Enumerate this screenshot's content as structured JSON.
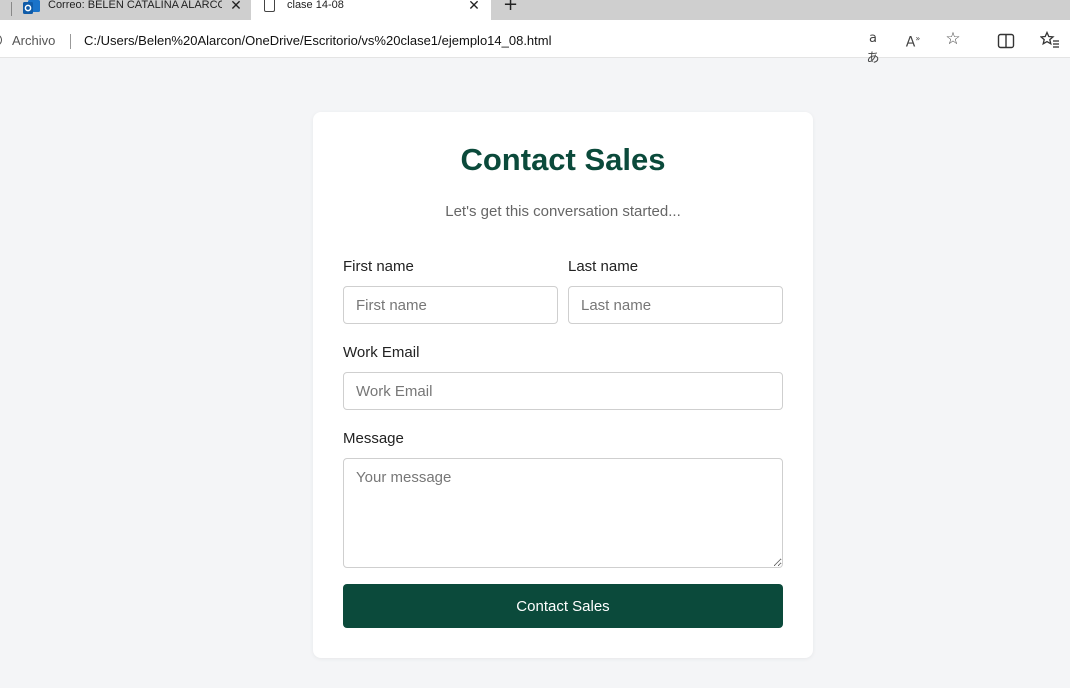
{
  "browser": {
    "tabs": [
      {
        "label": "Correo: BELEN CATALINA ALARCON",
        "icon": "outlook-icon"
      },
      {
        "label": "clase 14-08",
        "icon": "document-icon"
      }
    ],
    "new_tab_symbol": "+",
    "close_symbol": "✕",
    "address": {
      "scheme_label": "Archivo",
      "url": "C:/Users/Belen%20Alarcon/OneDrive/Escritorio/vs%20clase1/ejemplo14_08.html"
    },
    "toolbar_icons": [
      "translate-icon",
      "read-aloud-icon",
      "favorite-star-icon",
      "split-screen-icon",
      "favorites-icon"
    ]
  },
  "form": {
    "title": "Contact Sales",
    "subtitle": "Let's get this conversation started...",
    "first_name": {
      "label": "First name",
      "placeholder": "First name",
      "value": ""
    },
    "last_name": {
      "label": "Last name",
      "placeholder": "Last name",
      "value": ""
    },
    "email": {
      "label": "Work Email",
      "placeholder": "Work Email",
      "value": ""
    },
    "message": {
      "label": "Message",
      "placeholder": "Your message",
      "value": ""
    },
    "submit_label": "Contact Sales"
  },
  "colors": {
    "accent": "#0b4a3b",
    "page_background": "#f4f5f7",
    "card_background": "#ffffff"
  }
}
